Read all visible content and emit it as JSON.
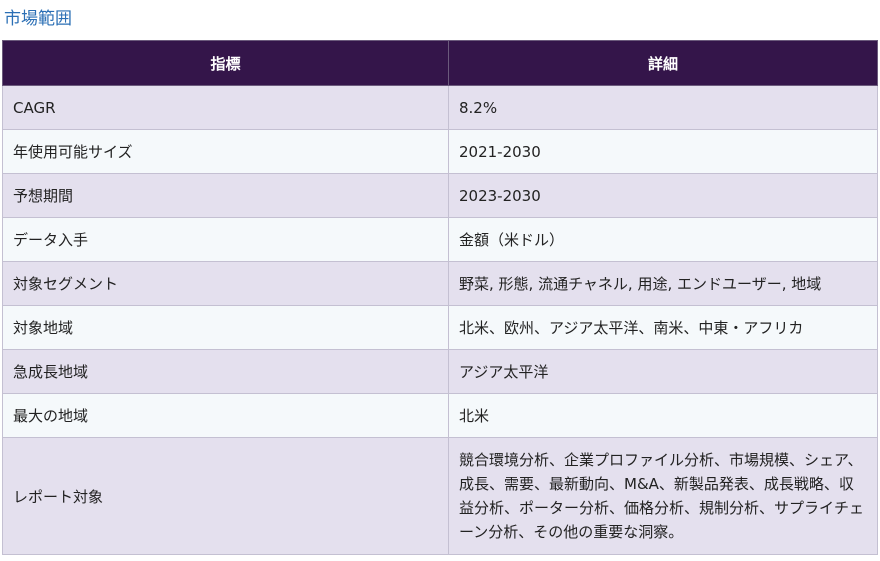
{
  "section_title": "市場範囲",
  "table": {
    "headers": [
      "指標",
      "詳細"
    ],
    "rows": [
      {
        "label": "CAGR",
        "value": "8.2%"
      },
      {
        "label": "年使用可能サイズ",
        "value": "2021-2030"
      },
      {
        "label": "予想期間",
        "value": "2023-2030"
      },
      {
        "label": "データ入手",
        "value": "金額（米ドル）"
      },
      {
        "label": "対象セグメント",
        "value": "野菜, 形態, 流通チャネル, 用途, エンドユーザー, 地域"
      },
      {
        "label": "対象地域",
        "value": "北米、欧州、アジア太平洋、南米、中東・アフリカ"
      },
      {
        "label": "急成長地域",
        "value": "アジア太平洋"
      },
      {
        "label": "最大の地域",
        "value": "北米"
      },
      {
        "label": "レポート対象",
        "value": "競合環境分析、企業プロファイル分析、市場規模、シェア、成長、需要、最新動向、M&A、新製品発表、成長戦略、収益分析、ポーター分析、価格分析、規制分析、サプライチェーン分析、その他の重要な洞察。"
      }
    ]
  }
}
